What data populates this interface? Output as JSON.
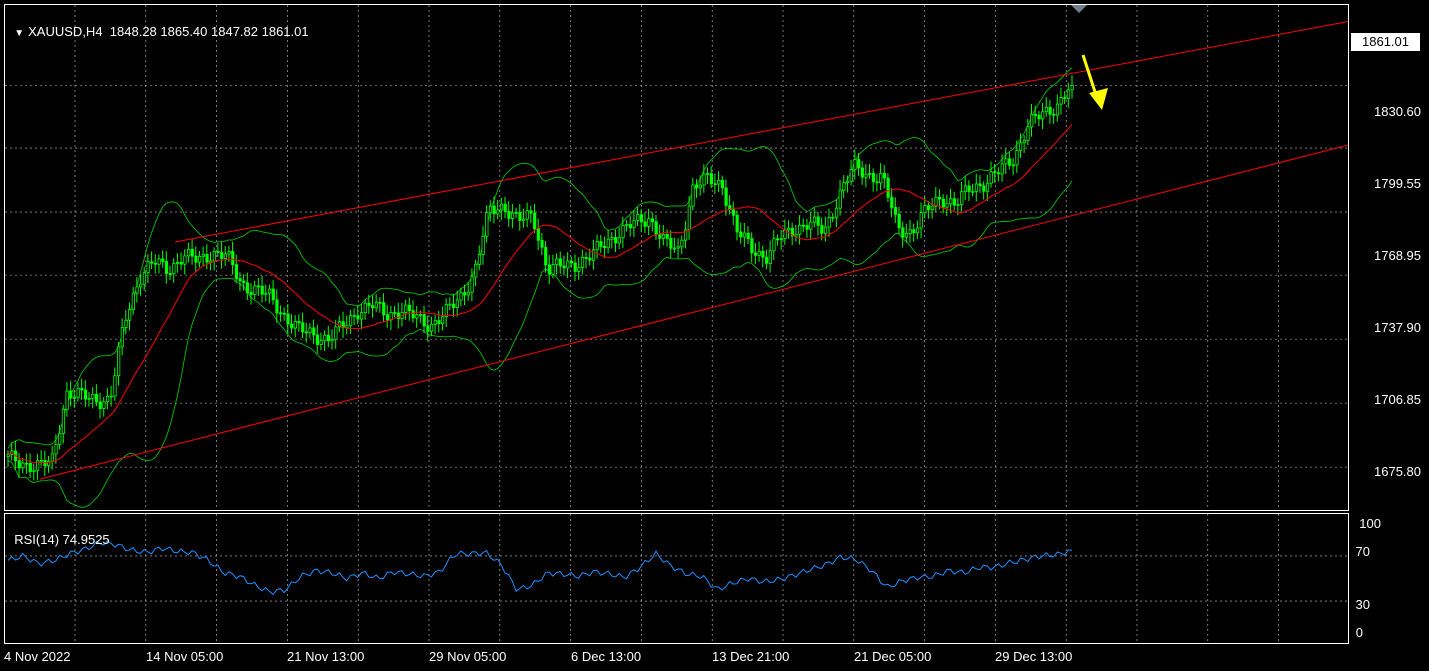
{
  "header": {
    "symbol_label": "XAUUSD,H4",
    "ohlc_text": "1848.28 1865.40 1847.82 1861.01",
    "menu_icon": "triangle-down-icon"
  },
  "price_tag": "1861.01",
  "colors": {
    "background": "#000000",
    "grid": "#c8c8c8",
    "bull_candle": "#00ff00",
    "ma": "#ff0000",
    "bollinger": "#00c000",
    "channel": "#ff0000",
    "rsi": "#1e90ff",
    "arrow": "#ffff00"
  },
  "rsi": {
    "label": "RSI(14)",
    "value": "74.9525",
    "levels": [
      "100",
      "70",
      "30",
      "0"
    ]
  },
  "chart_data": {
    "type": "candlestick",
    "symbol": "XAUUSD",
    "timeframe": "H4",
    "ylim": [
      1655,
      1900
    ],
    "y_ticks": [
      "1830.60",
      "1799.55",
      "1768.95",
      "1737.90",
      "1706.85",
      "1675.80"
    ],
    "x_ticks": [
      "4 Nov 2022",
      "14 Nov 05:00",
      "21 Nov 13:00",
      "29 Nov 05:00",
      "6 Dec 13:00",
      "13 Dec 21:00",
      "21 Dec 05:00",
      "29 Dec 13:00"
    ],
    "last": {
      "open": 1848.28,
      "high": 1865.4,
      "low": 1847.82,
      "close": 1861.01
    },
    "close_path": [
      1680,
      1678,
      1676,
      1678,
      1712,
      1710,
      1709,
      1708,
      1747,
      1768,
      1775,
      1772,
      1778,
      1776,
      1780,
      1778,
      1765,
      1762,
      1758,
      1749,
      1742,
      1740,
      1738,
      1744,
      1752,
      1754,
      1750,
      1752,
      1748,
      1745,
      1750,
      1758,
      1770,
      1800,
      1803,
      1795,
      1798,
      1772,
      1773,
      1775,
      1778,
      1785,
      1790,
      1794,
      1797,
      1785,
      1780,
      1812,
      1815,
      1813,
      1790,
      1782,
      1778,
      1787,
      1792,
      1794,
      1790,
      1808,
      1821,
      1818,
      1816,
      1792,
      1790,
      1800,
      1807,
      1803,
      1811,
      1814,
      1819,
      1826,
      1842,
      1847,
      1852,
      1861.01
    ],
    "channel_upper": {
      "start": 1785,
      "end": 1892
    },
    "channel_lower": {
      "start": 1670,
      "end": 1832
    },
    "rsi_path": [
      66,
      70,
      63,
      66,
      72,
      76,
      82,
      80,
      75,
      73,
      77,
      74,
      73,
      66,
      55,
      52,
      44,
      38,
      40,
      52,
      57,
      55,
      50,
      55,
      50,
      56,
      54,
      52,
      56,
      72,
      72,
      73,
      62,
      40,
      44,
      55,
      54,
      52,
      56,
      54,
      51,
      60,
      72,
      61,
      54,
      52,
      40,
      46,
      50,
      47,
      49,
      53,
      58,
      62,
      69,
      67,
      57,
      42,
      48,
      51,
      52,
      57,
      55,
      60,
      60,
      64,
      67,
      70,
      71,
      74.95
    ]
  }
}
